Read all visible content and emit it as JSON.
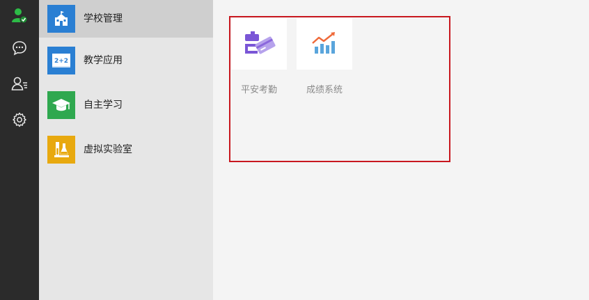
{
  "rail": {
    "items": [
      {
        "icon": "user-badge-icon",
        "color": "#2dbb47"
      },
      {
        "icon": "chat-bubble-icon"
      },
      {
        "icon": "user-list-icon"
      },
      {
        "icon": "gear-icon"
      }
    ]
  },
  "sidebar": {
    "items": [
      {
        "label": "学校管理",
        "icon": "school-icon",
        "color": "#2a7fd3",
        "active": true
      },
      {
        "label": "教学应用",
        "icon": "blackboard-icon",
        "color": "#2a7fd3"
      },
      {
        "label": "自主学习",
        "icon": "graduation-cap-icon",
        "color": "#2fa84f"
      },
      {
        "label": "虚拟实验室",
        "icon": "lab-flask-icon",
        "color": "#e8a90f"
      }
    ]
  },
  "main": {
    "apps": [
      {
        "label": "平安考勤",
        "icon": "attendance-card-icon",
        "color": "#8b67dc"
      },
      {
        "label": "成绩系统",
        "icon": "grade-chart-icon",
        "color": "#5aa5dc"
      }
    ],
    "highlight_color": "#c8171e"
  }
}
